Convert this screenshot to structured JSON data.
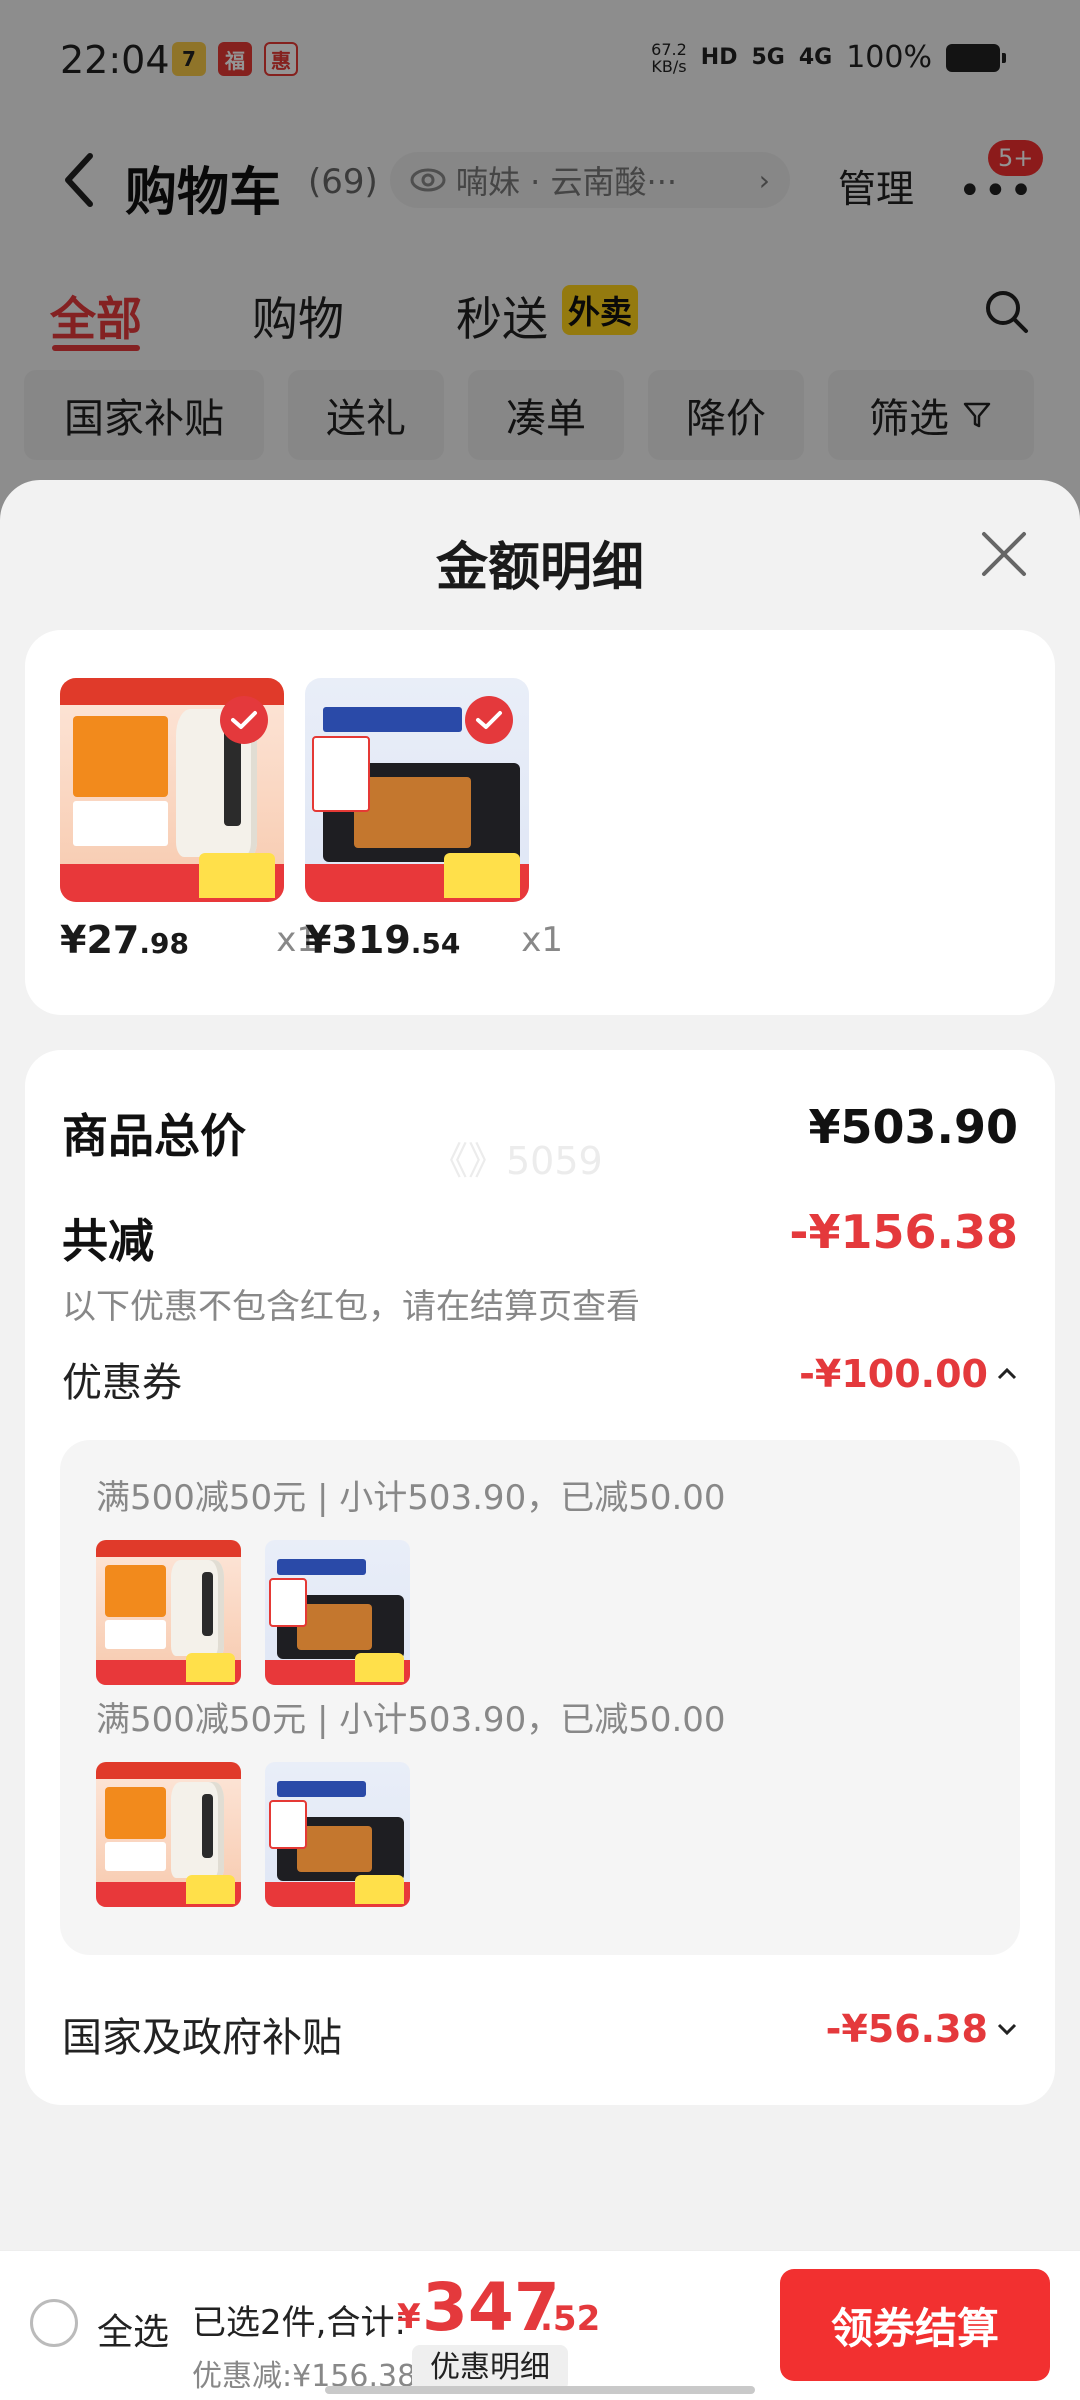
{
  "status_bar": {
    "time": "22:04",
    "net_speed_value": "67.2",
    "net_speed_unit": "KB/s",
    "hd": "HD",
    "net_5g": "5G",
    "net_4g": "4G",
    "battery": "100%"
  },
  "nav": {
    "title": "购物车",
    "count": "(69)",
    "address": "喃妹 · 云南酸···",
    "manage": "管理",
    "more": "•••",
    "badge": "5+"
  },
  "tabs": [
    {
      "label": "全部"
    },
    {
      "label": "购物"
    },
    {
      "label": "秒送"
    }
  ],
  "tab_badge": "外卖",
  "chips": [
    {
      "label": "国家补贴"
    },
    {
      "label": "送礼"
    },
    {
      "label": "凑单"
    },
    {
      "label": "降价"
    },
    {
      "label": "筛选"
    }
  ],
  "sheet": {
    "title": "金额明细",
    "items": [
      {
        "price_int": "¥27",
        "price_dec": ".98",
        "qty": "x1",
        "icon": "kettle"
      },
      {
        "price_int": "¥319",
        "price_dec": ".54",
        "qty": "x1",
        "icon": "microwave"
      }
    ],
    "summary": {
      "total_label": "商品总价",
      "total_value": "¥503.90",
      "watermark": "《》5059",
      "reduce_label": "共减",
      "reduce_value": "-¥156.38",
      "reduce_note": "以下优惠不包含红包，请在结算页查看",
      "coupon_label": "优惠券",
      "coupon_value": "-¥100.00",
      "coupon_groups": [
        {
          "text": "满500减50元 | 小计503.90，已减50.00"
        },
        {
          "text": "满500减50元 | 小计503.90，已减50.00"
        }
      ],
      "subsidy_label": "国家及政府补贴",
      "subsidy_value": "-¥56.38"
    }
  },
  "bottom_bar": {
    "select_all": "全选",
    "selected_info": "已选2件,合计:",
    "cny": "¥",
    "total_int": "347",
    "total_dec": ".52",
    "discount_info": "优惠减:¥156.38",
    "detail_btn": "优惠明细",
    "checkout_btn": "领券结算"
  },
  "colors": {
    "accent": "#e4393c",
    "checkout": "#f23030",
    "tab_badge": "#ffd31a"
  }
}
